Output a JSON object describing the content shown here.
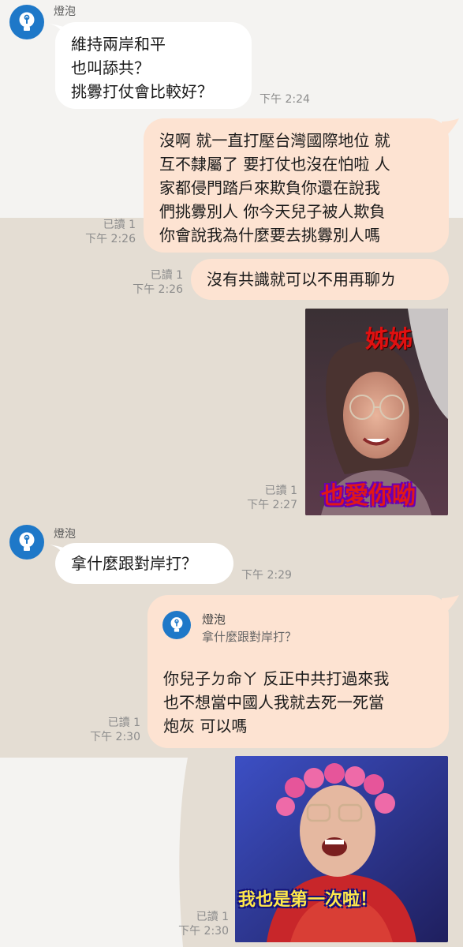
{
  "contact": {
    "name": "燈泡"
  },
  "colors": {
    "incoming_bubble": "#ffffff",
    "outgoing_bubble": "#fde3d2",
    "avatar": "#1e78c8",
    "background": "#e4ddd3"
  },
  "messages": {
    "m1": {
      "lines": [
        "維持兩岸和平",
        "也叫舔共？",
        "挑釁打仗會比較好？"
      ],
      "time": "下午 2:24"
    },
    "m2": {
      "lines": [
        "沒啊 就一直打壓台灣國際地位 就",
        "互不隸屬了 要打仗也沒在怕啦 人",
        "家都侵門踏戶來欺負你還在說我",
        "們挑釁別人 你今天兒子被人欺負",
        "你會說我為什麼要去挑釁別人嗎"
      ],
      "read": "已讀 1",
      "time": "下午 2:26"
    },
    "m3": {
      "lines": [
        "沒有共識就可以不用再聊ㄌ"
      ],
      "read": "已讀 1",
      "time": "下午 2:26"
    },
    "m4": {
      "caption_top": "姊姊",
      "caption_bottom": "也愛你呦",
      "read": "已讀 1",
      "time": "下午 2:27"
    },
    "m5": {
      "lines": [
        "拿什麼跟對岸打？"
      ],
      "time": "下午 2:29"
    },
    "m6": {
      "quote_name": "燈泡",
      "quote_text": "拿什麼跟對岸打？",
      "lines": [
        "你兒子ㄉ命ㄚ 反正中共打過來我",
        "也不想當中國人我就去死一死當",
        "炮灰 可以嗎"
      ],
      "read": "已讀 1",
      "time": "下午 2:30"
    },
    "m7": {
      "caption": "我也是第一次啦！",
      "read": "已讀 1",
      "time": "下午 2:30"
    }
  }
}
